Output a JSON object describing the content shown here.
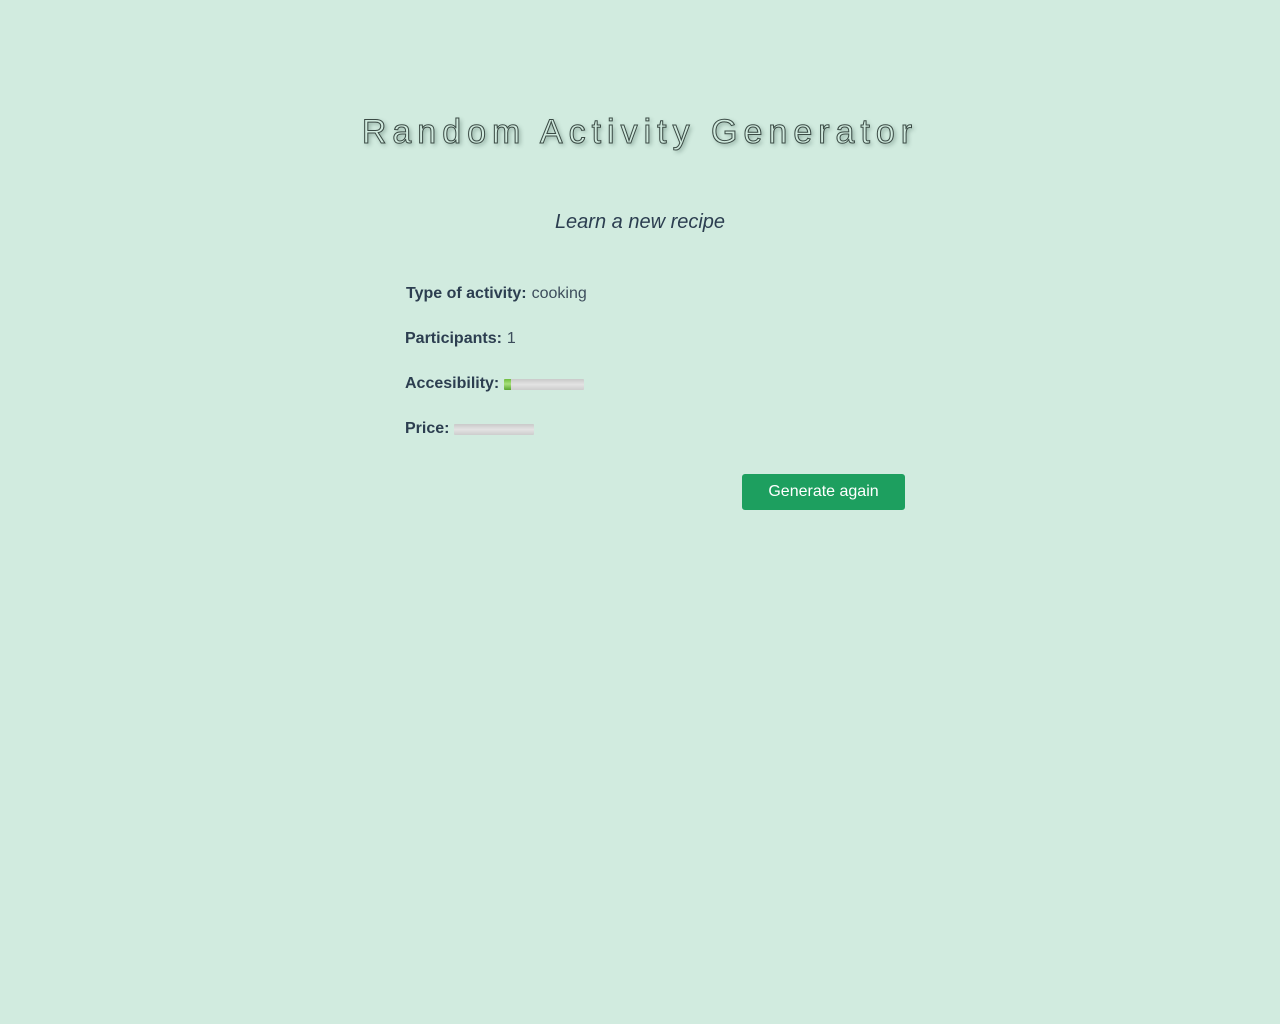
{
  "title": "Random Activity Generator",
  "activity": "Learn a new recipe",
  "details": {
    "type_label": "Type of activity:",
    "type_value": "cooking",
    "participants_label": "Participants:",
    "participants_value": "1",
    "accessibility_label": "Accesibility:",
    "accessibility_level": 0.08,
    "price_label": "Price:",
    "price_level": 0
  },
  "button": {
    "generate_label": "Generate again"
  },
  "colors": {
    "background": "#d1ebdf",
    "button": "#1d9f5f",
    "meter_fill": "#6fbd3d"
  }
}
